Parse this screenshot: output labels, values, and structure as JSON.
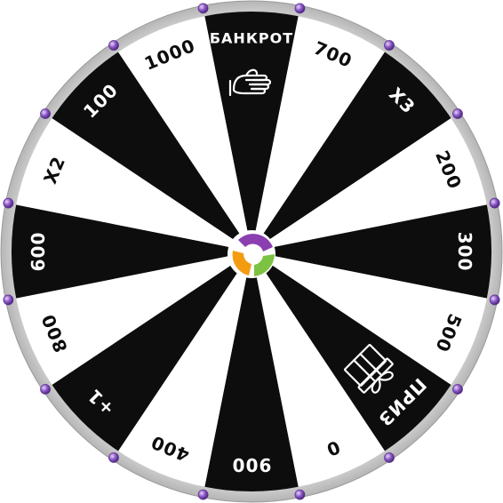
{
  "wheel": {
    "colors": {
      "dark": "#0d0d0d",
      "light": "#ffffff",
      "rim": "#c9c9c9",
      "rim_edge": "#a8a8a8",
      "peg": "#8a55c8",
      "peg_highlight": "#d9c4f2",
      "hub_purple": "#8b3fb0",
      "hub_green": "#7dc242",
      "hub_orange": "#f39c12",
      "hub_white": "#ffffff"
    },
    "segments": [
      {
        "label": "БАНКРОТ",
        "fill": "dark",
        "icon": "hand-icon"
      },
      {
        "label": "700",
        "fill": "light"
      },
      {
        "label": "Х3",
        "fill": "dark"
      },
      {
        "label": "200",
        "fill": "light"
      },
      {
        "label": "300",
        "fill": "dark"
      },
      {
        "label": "500",
        "fill": "light"
      },
      {
        "label": "ПРИЗ",
        "fill": "dark",
        "icon": "gift-icon"
      },
      {
        "label": "0",
        "fill": "light"
      },
      {
        "label": "900",
        "fill": "dark"
      },
      {
        "label": "400",
        "fill": "light"
      },
      {
        "label": "+1",
        "fill": "dark"
      },
      {
        "label": "800",
        "fill": "light"
      },
      {
        "label": "600",
        "fill": "dark"
      },
      {
        "label": "Х2",
        "fill": "light"
      },
      {
        "label": "100",
        "fill": "dark"
      },
      {
        "label": "1000",
        "fill": "light"
      }
    ]
  }
}
